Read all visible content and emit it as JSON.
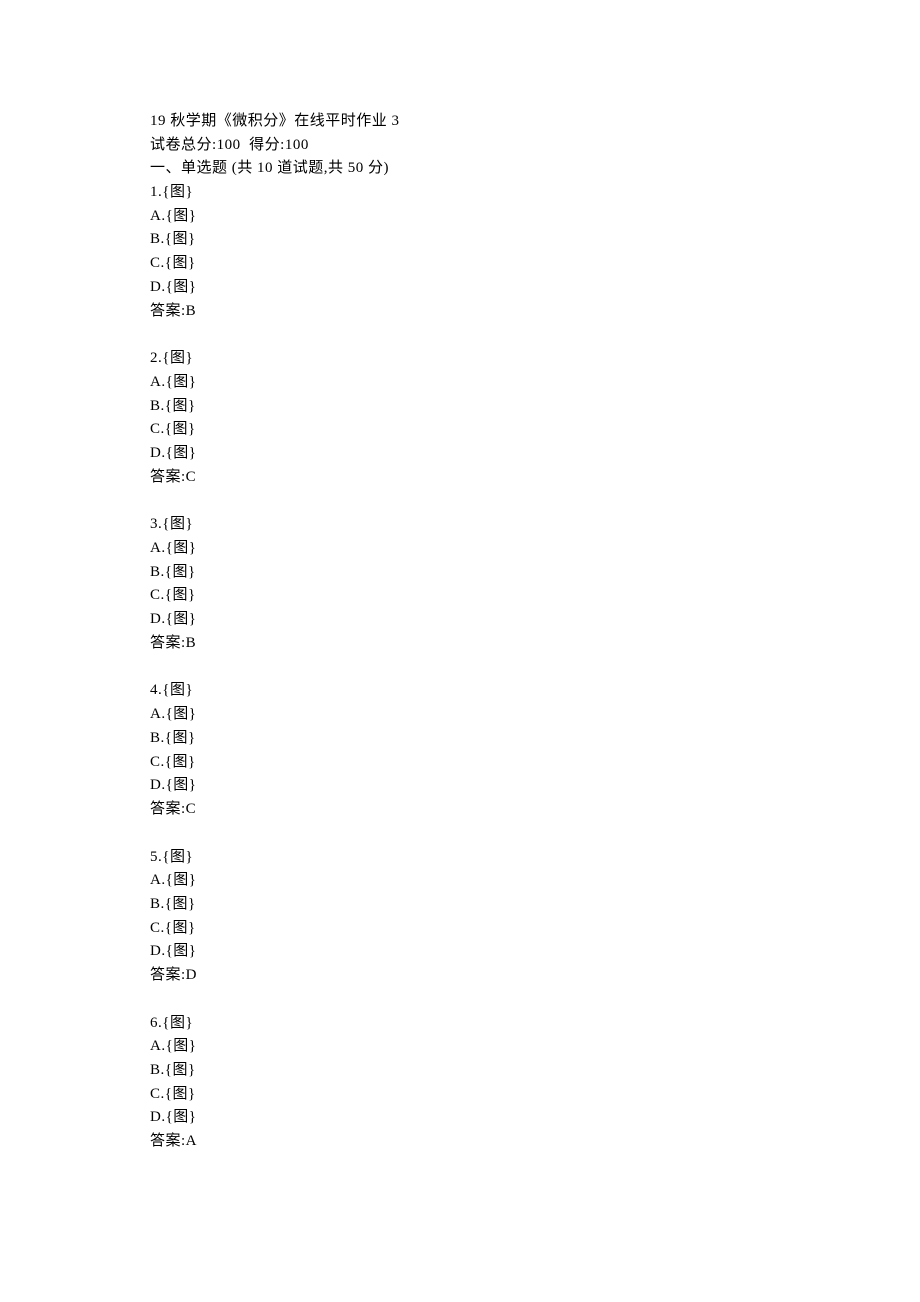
{
  "header": {
    "title_line": "19 秋学期《微积分》在线平时作业 3",
    "score_line": "试卷总分:100  得分:100",
    "section_line": "一、单选题 (共 10 道试题,共 50 分)"
  },
  "questions": [
    {
      "num": "1",
      "q": "{图}",
      "opts": {
        "A": "{图}",
        "B": "{图}",
        "C": "{图}",
        "D": "{图}"
      },
      "answer": "B"
    },
    {
      "num": "2",
      "q": "{图}",
      "opts": {
        "A": "{图}",
        "B": "{图}",
        "C": "{图}",
        "D": "{图}"
      },
      "answer": "C"
    },
    {
      "num": "3",
      "q": "{图}",
      "opts": {
        "A": "{图}",
        "B": "{图}",
        "C": "{图}",
        "D": "{图}"
      },
      "answer": "B"
    },
    {
      "num": "4",
      "q": "{图}",
      "opts": {
        "A": "{图}",
        "B": "{图}",
        "C": "{图}",
        "D": "{图}"
      },
      "answer": "C"
    },
    {
      "num": "5",
      "q": "{图}",
      "opts": {
        "A": "{图}",
        "B": "{图}",
        "C": "{图}",
        "D": "{图}"
      },
      "answer": "D"
    },
    {
      "num": "6",
      "q": "{图}",
      "opts": {
        "A": "{图}",
        "B": "{图}",
        "C": "{图}",
        "D": "{图}"
      },
      "answer": "A"
    }
  ],
  "labels": {
    "answer_prefix": "答案:"
  }
}
